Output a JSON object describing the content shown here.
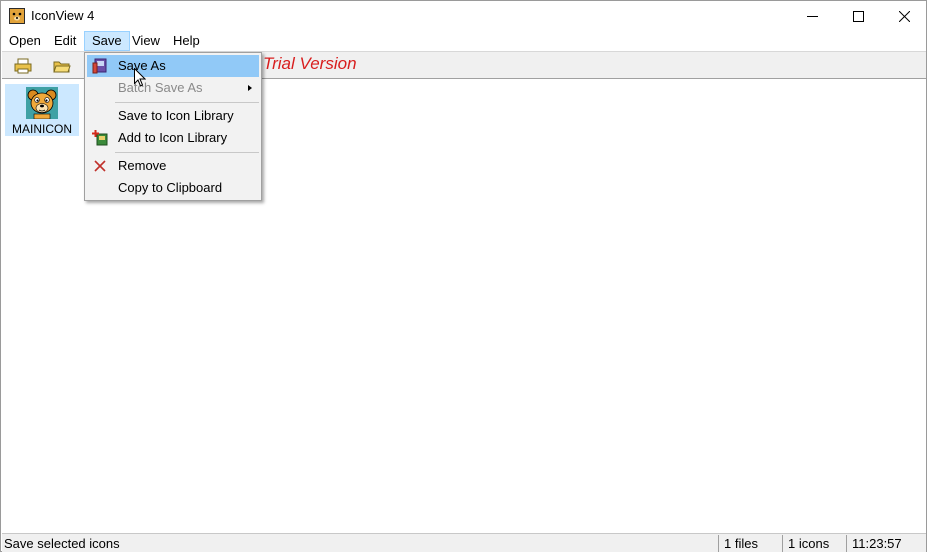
{
  "window": {
    "title": "IconView 4"
  },
  "menubar": {
    "items": [
      "Open",
      "Edit",
      "Save",
      "View",
      "Help"
    ]
  },
  "toolbar": {
    "trial_text": "Trial Version"
  },
  "save_menu": {
    "items": [
      {
        "label": "Save As",
        "icon": "save-as-icon"
      },
      {
        "label": "Batch Save As"
      },
      {
        "label": "Save to Icon Library"
      },
      {
        "label": "Add to Icon Library",
        "icon": "add-library-icon"
      },
      {
        "label": "Remove",
        "icon": "remove-icon"
      },
      {
        "label": "Copy to Clipboard"
      }
    ]
  },
  "content": {
    "icons": [
      {
        "label": "MAINICON"
      }
    ]
  },
  "statusbar": {
    "text": "Save selected icons",
    "files": "1 files",
    "icons": "1 icons",
    "time": "11:23:57"
  },
  "colors": {
    "trial_text": "#d81e1e",
    "menu_highlight": "#91c9f7",
    "selection": "#cce8ff"
  }
}
